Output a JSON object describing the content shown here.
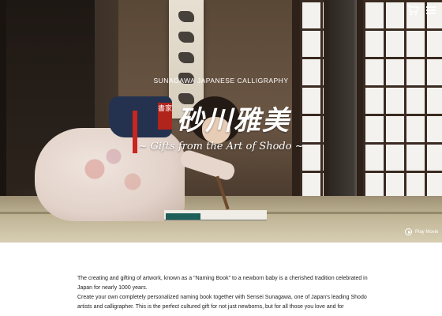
{
  "header": {
    "icons": [
      "cart-icon",
      "menu-icon"
    ],
    "play_movie_label": "Play Movie"
  },
  "hero": {
    "brand_subtitle": "SUNAGAWA JAPANESE CALLIGRAPHY",
    "seal_text": "書家",
    "brand_name": "砂川雅美",
    "tagline": "~ Gifts from the Art of Shodo ~"
  },
  "intro": {
    "paragraph_1": "The creating and gifting of artwork, known as a \"Naming Book\" to a newborn baby is a cherished tradition celebrated in Japan for nearly 1000 years.",
    "paragraph_2": "Create your own completely personalized naming book together with Sensei Sunagawa, one of Japan's leading Shodo artists and calligrapher. This is the perfect cultured gift for not just newborns, but for all those you love and for"
  },
  "colors": {
    "seal_red": "#b1241c",
    "text": "#222222",
    "background": "#ffffff"
  }
}
